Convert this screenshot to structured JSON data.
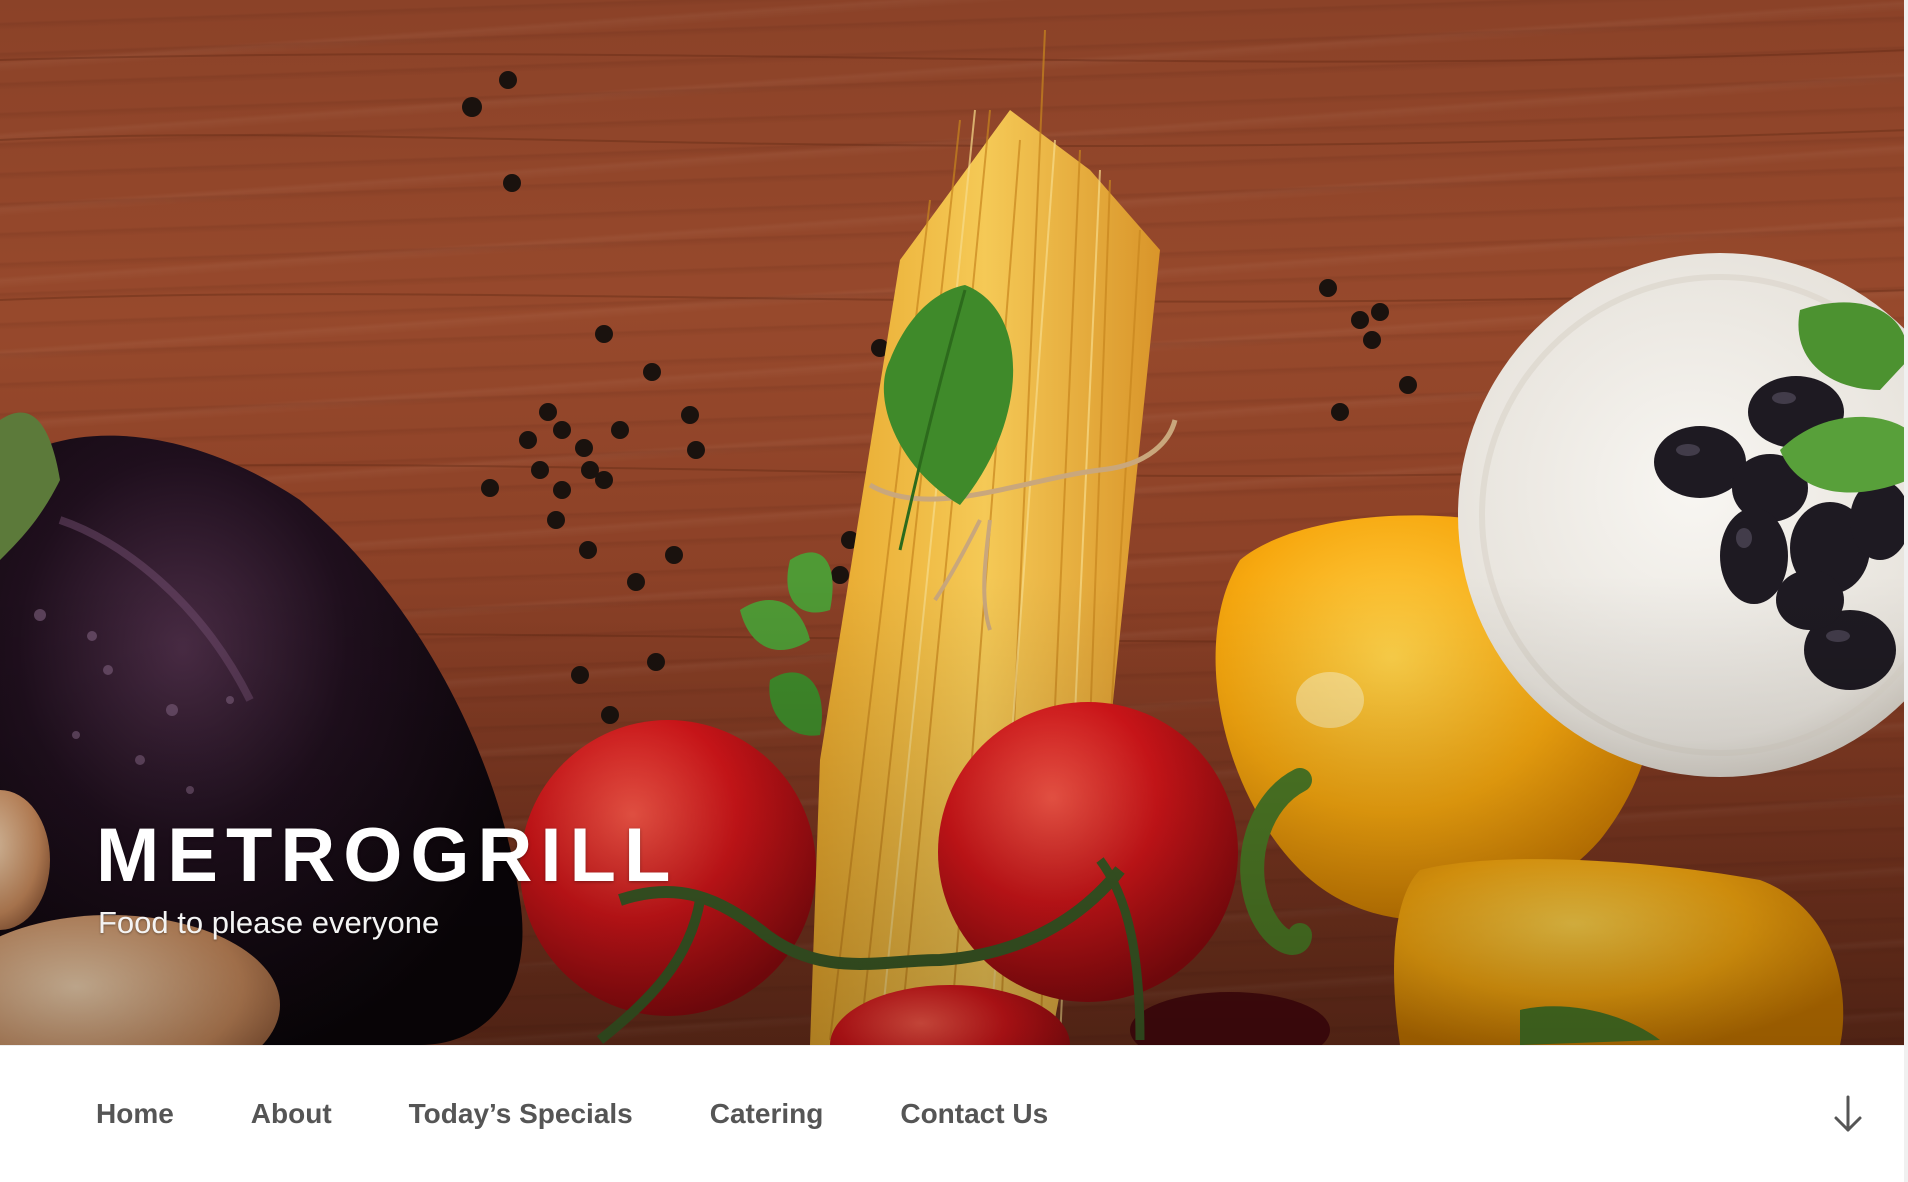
{
  "site": {
    "title": "METROGRILL",
    "tagline": "Food to please everyone"
  },
  "nav": {
    "items": [
      {
        "label": "Home"
      },
      {
        "label": "About"
      },
      {
        "label": "Today’s Specials"
      },
      {
        "label": "Catering"
      },
      {
        "label": "Contact Us"
      }
    ],
    "scroll_icon": "arrow-down-icon"
  },
  "hero": {
    "image": "header-image-vegetables-pasta"
  },
  "colors": {
    "title": "#ffffff",
    "nav_text": "#555555",
    "nav_background": "#ffffff",
    "wood": "#8b4228"
  }
}
